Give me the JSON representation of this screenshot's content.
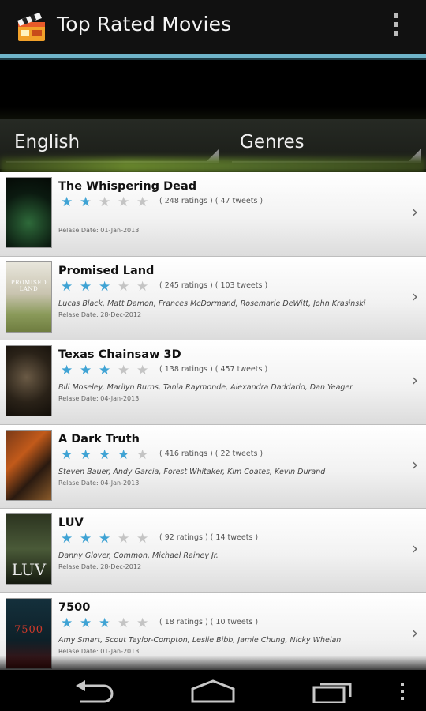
{
  "app": {
    "title": "Top Rated Movies"
  },
  "filters": {
    "language": "English",
    "genre": "Genres"
  },
  "movies": [
    {
      "title": "The Whispering Dead",
      "rating": 1.5,
      "counts": "( 248 ratings ) ( 47 tweets )",
      "cast": "",
      "date": "Relase Date: 01-Jan-2013",
      "poster_text": ""
    },
    {
      "title": "Promised Land",
      "rating": 3,
      "counts": "( 245 ratings ) ( 103 tweets )",
      "cast": "Lucas Black, Matt Damon, Frances McDormand, Rosemarie DeWitt, John Krasinski",
      "date": "Relase Date: 28-Dec-2012",
      "poster_text": "PROMISED LAND"
    },
    {
      "title": "Texas Chainsaw 3D",
      "rating": 3,
      "counts": "( 138 ratings ) ( 457 tweets )",
      "cast": "Bill Moseley, Marilyn Burns, Tania Raymonde, Alexandra Daddario, Dan Yeager",
      "date": "Relase Date: 04-Jan-2013",
      "poster_text": ""
    },
    {
      "title": "A Dark Truth",
      "rating": 3.5,
      "counts": "( 416 ratings ) ( 22 tweets )",
      "cast": "Steven Bauer, Andy Garcia, Forest Whitaker, Kim Coates, Kevin Durand",
      "date": "Relase Date: 04-Jan-2013",
      "poster_text": ""
    },
    {
      "title": "LUV",
      "rating": 3,
      "counts": "( 92 ratings ) ( 14 tweets )",
      "cast": "Danny Glover, Common, Michael Rainey Jr.",
      "date": "Relase Date: 28-Dec-2012",
      "poster_text": "LUV"
    },
    {
      "title": "7500",
      "rating": 2.5,
      "counts": "( 18 ratings ) ( 10 tweets )",
      "cast": "Amy Smart, Scout Taylor-Compton, Leslie Bibb, Jamie Chung, Nicky Whelan",
      "date": "Relase Date: 01-Jan-2013",
      "poster_text": "7500"
    }
  ],
  "icons": {
    "app": "clapperboard-icon",
    "overflow": "overflow-menu-icon",
    "back": "back-icon",
    "home": "home-icon",
    "recents": "recent-apps-icon"
  },
  "colors": {
    "accent": "#6fb4c9",
    "star_on": "#3fa3d4",
    "star_off": "#c4c4c4"
  }
}
